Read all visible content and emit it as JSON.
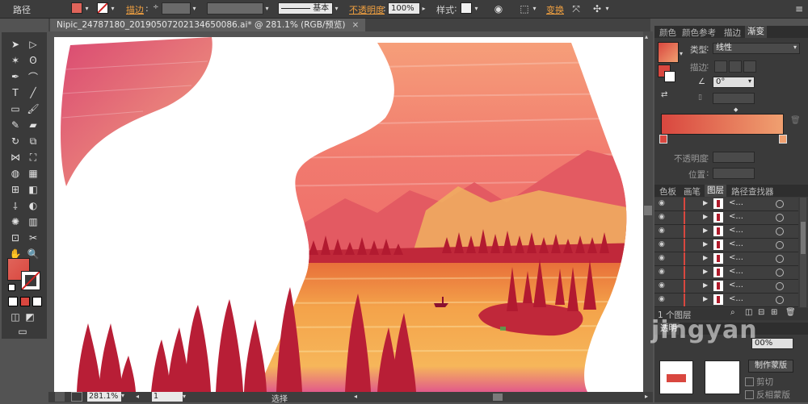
{
  "control_bar": {
    "path_label": "路径",
    "stroke_label": "描边",
    "stroke_weight_arrows": "÷",
    "brush_label": "基本",
    "opacity_label": "不透明度",
    "opacity_value": "100%",
    "style_label": "样式",
    "transform_label": "变换"
  },
  "document": {
    "tab_title": "Nipic_24787180_20190507202134650086.ai* @ 281.1% (RGB/预览)",
    "close": "×"
  },
  "status_bar": {
    "zoom": "281.1%",
    "artboard_num": "1",
    "tool_status": "选择"
  },
  "panels": {
    "top_tabs": [
      "颜色",
      "颜色参考",
      "描边",
      "渐变"
    ],
    "gradient": {
      "type_label": "类型",
      "type_value": "线性",
      "stroke_label": "描边",
      "angle_value": "0°",
      "opacity_label": "不透明度",
      "location_label": "位置"
    },
    "layer_tabs": [
      "色板",
      "画笔",
      "图层",
      "路径查找器"
    ],
    "layer_rows": [
      "<...",
      "<...",
      "<...",
      "<...",
      "<...",
      "<...",
      "<...",
      "<..."
    ],
    "layer_count": "1 个图层",
    "transparency_tab": "透明",
    "transparency_value": "00%",
    "make_mask_button": "制作蒙版",
    "clip_label": "剪切",
    "invert_mask_label": "反相蒙版"
  },
  "watermark": "jingyan",
  "colors": {
    "fill": "#e0645a",
    "gradient_start": "#d9473f",
    "gradient_end": "#f0a070",
    "accent_orange": "#f0a040"
  }
}
